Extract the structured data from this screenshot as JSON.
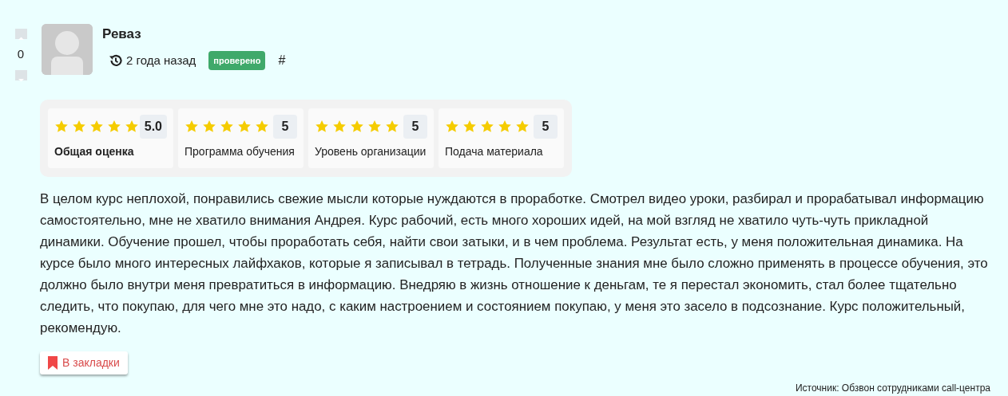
{
  "vote": {
    "score": "0"
  },
  "author": {
    "name": "Реваз",
    "time": "2 года назад",
    "badge": "проверено",
    "anchor": "#"
  },
  "ratings": [
    {
      "kind": "overall",
      "stars": 5,
      "value": "5.0",
      "label": "Общая оценка"
    },
    {
      "kind": "criterion",
      "stars": 5,
      "value": "5",
      "label": "Программа обучения"
    },
    {
      "kind": "criterion",
      "stars": 5,
      "value": "5",
      "label": "Уровень организации"
    },
    {
      "kind": "criterion",
      "stars": 5,
      "value": "5",
      "label": "Подача материала"
    }
  ],
  "text": "В целом курс неплохой, понравились свежие мысли которые нуждаются в проработке. Смотрел видео уроки, разбирал и прорабатывал информацию самостоятельно, мне не хватило внимания Андрея. Курс рабочий, есть много хороших идей, на мой взгляд не хватило чуть-чуть прикладной динамики. Обучение прошел, чтобы проработать себя, найти свои затыки, и в чем проблема. Результат есть, у меня положительная динамика. На курсе было много интересных лайфхаков, которые я записывал в тетрадь. Полученные знания мне было сложно применять в процессе обучения, это должно было внутри меня превратиться в информацию. Внедряю в жизнь отношение к деньгам, те я перестал экономить, стал более тщательно следить, что покупаю, для чего мне это надо, с каким настроением и состоянием покупаю, у меня это засело в подсознание. Курс положительный, рекомендую.",
  "bookmark_button": "В закладки",
  "source": "Источник: Обзвон сотрудниками call-центра"
}
